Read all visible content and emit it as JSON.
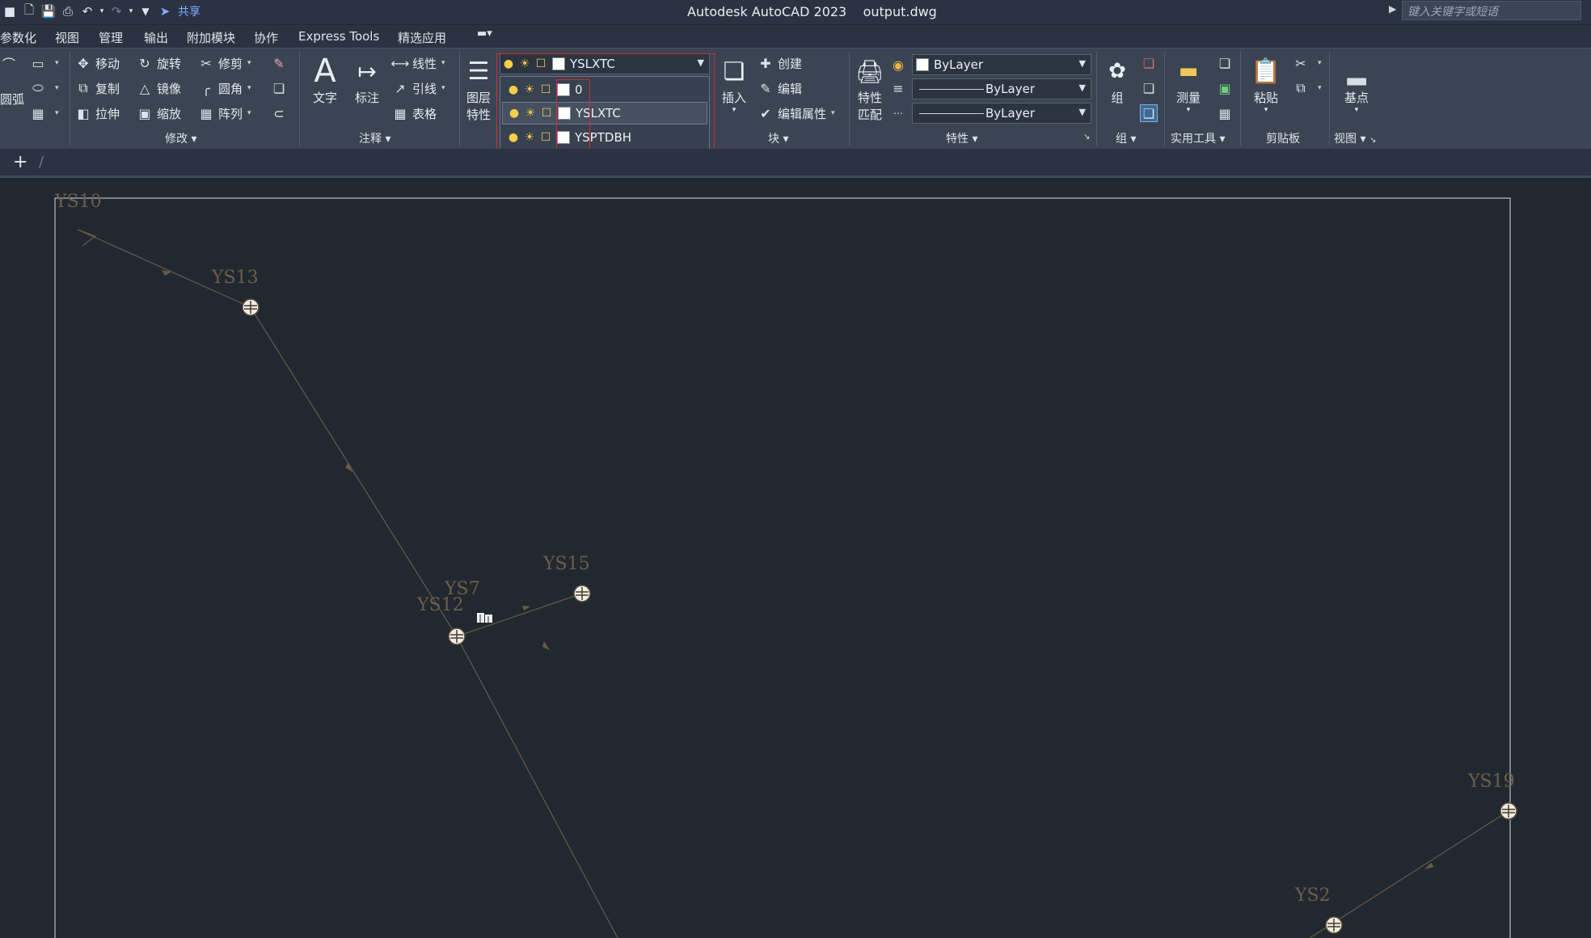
{
  "app": {
    "title": "Autodesk AutoCAD 2023",
    "filename": "output.dwg",
    "share_label": "共享",
    "search_placeholder": "键入关键字或短语"
  },
  "menu": [
    "参数化",
    "视图",
    "管理",
    "输出",
    "附加模块",
    "协作",
    "Express Tools",
    "精选应用"
  ],
  "ribbon": {
    "draw_partial": {
      "arc_label": "圆弧"
    },
    "modify": {
      "title": "修改",
      "move": "移动",
      "rotate": "旋转",
      "trim": "修剪",
      "copy": "复制",
      "mirror": "镜像",
      "fillet": "圆角",
      "stretch": "拉伸",
      "scale": "缩放",
      "array": "阵列"
    },
    "annotation": {
      "title": "注释",
      "text": "文字",
      "dimension": "标注",
      "linear": "线性",
      "leader": "引线",
      "table": "表格"
    },
    "layers": {
      "properties_line1": "图层",
      "properties_line2": "特性",
      "current_layer": "YSLXTC",
      "list": [
        "0",
        "YSLXTC",
        "YSPTDBH"
      ],
      "selected_index": 1
    },
    "block": {
      "title": "块",
      "insert": "插入",
      "create": "创建",
      "edit": "编辑",
      "edit_attributes": "编辑属性"
    },
    "properties": {
      "title": "特性",
      "match_line1": "特性",
      "match_line2": "匹配",
      "color": "ByLayer",
      "lineweight": "ByLayer",
      "linetype": "ByLayer"
    },
    "groups": {
      "title": "组",
      "group": "组"
    },
    "utilities": {
      "title": "实用工具",
      "measure": "测量"
    },
    "clipboard": {
      "title": "剪贴板",
      "paste": "粘贴"
    },
    "view": {
      "title": "视图",
      "base_point": "基点"
    }
  },
  "drawing": {
    "labels": {
      "ys10": "YS10",
      "ys13": "YS13",
      "ys15": "YS15",
      "ys7": "YS7",
      "ys12": "YS12",
      "ys19": "YS19",
      "ys2": "YS2"
    }
  },
  "colors": {
    "canvas_bg": "#212830",
    "ribbon_bg": "#3b4453",
    "highlight_red": "#d42a36",
    "pipe_line": "#6b5a46",
    "label_text": "#6f5e4b"
  }
}
